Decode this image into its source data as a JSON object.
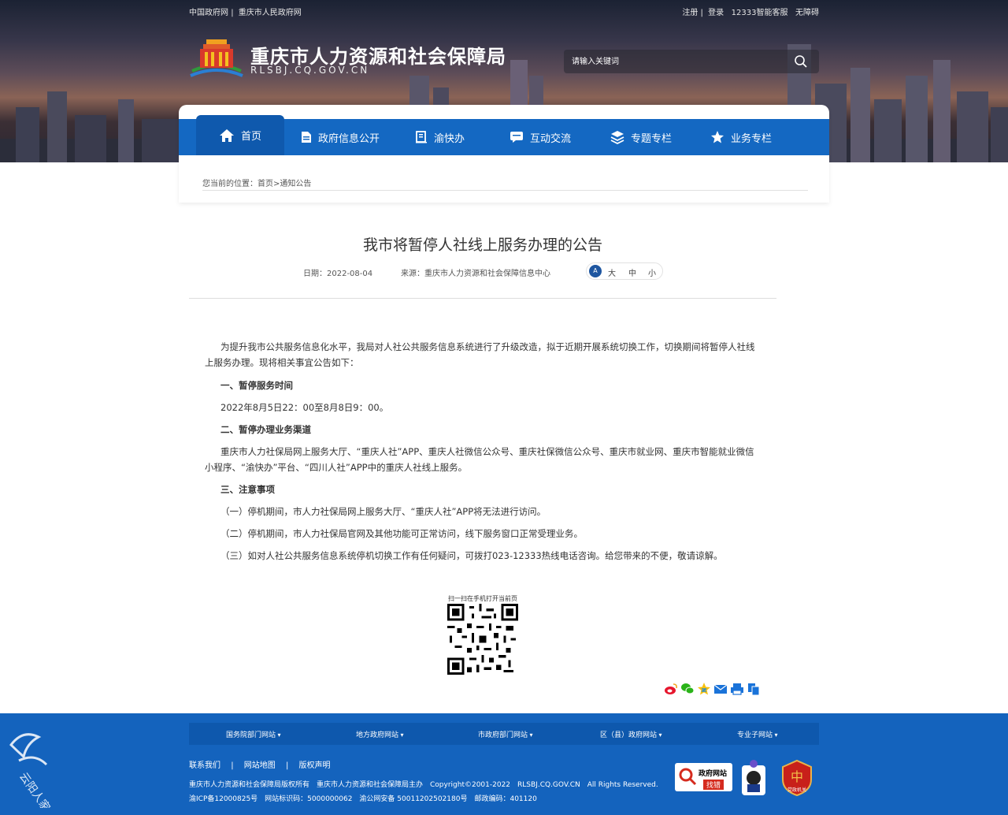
{
  "topbar": {
    "left_link1": "中国政府网",
    "separator": "|",
    "left_link2": "重庆市人民政府网",
    "register": "注册",
    "login": "登录",
    "service": "12333智能客服",
    "accessible": "无障碍"
  },
  "header": {
    "title": "重庆市人力资源和社会保障局",
    "domain": "RLSBJ.CQ.GOV.CN",
    "search_placeholder": "请输入关键词"
  },
  "nav": {
    "items": [
      {
        "label": "首页",
        "icon": "home-icon"
      },
      {
        "label": "政府信息公开",
        "icon": "document-icon"
      },
      {
        "label": "渝快办",
        "icon": "book-icon"
      },
      {
        "label": "互动交流",
        "icon": "chat-icon"
      },
      {
        "label": "专题专栏",
        "icon": "layers-icon"
      },
      {
        "label": "业务专栏",
        "icon": "star-icon"
      }
    ]
  },
  "breadcrumb": {
    "prefix": "您当前的位置：",
    "home": "首页",
    "sep": ">",
    "current": "通知公告"
  },
  "article": {
    "title": "我市将暂停人社线上服务办理的公告",
    "date": "日期：2022-08-04",
    "source": "来源：重庆市人力资源和社会保障信息中心",
    "font_icon": "A",
    "font_large": "大",
    "font_medium": "中",
    "font_small": "小",
    "paragraphs": {
      "p1": "为提升我市公共服务信息化水平，我局对人社公共服务信息系统进行了升级改造，拟于近期开展系统切换工作，切换期间将暂停人社线上服务办理。现将相关事宜公告如下：",
      "h1": "一、暂停服务时间",
      "p2": "2022年8月5日22：00至8月8日9：00。",
      "h2": "二、暂停办理业务渠道",
      "p3": "重庆市人力社保局网上服务大厅、“重庆人社”APP、重庆人社微信公众号、重庆社保微信公众号、重庆市就业网、重庆市智能就业微信小程序、“渝快办”平台、“四川人社”APP中的重庆人社线上服务。",
      "h3": "三、注意事项",
      "i1": "（一）停机期间，市人力社保局网上服务大厅、“重庆人社”APP将无法进行访问。",
      "i2": "（二）停机期间，市人力社保局官网及其他功能可正常访问，线下服务窗口正常受理业务。",
      "i3": "（三）如对人社公共服务信息系统停机切换工作有任何疑问，可拨打023-12333热线电话咨询。给您带来的不便，敬请谅解。"
    },
    "qr_label": "扫一扫在手机打开当前页"
  },
  "share_icons": [
    "weibo-icon",
    "wechat-icon",
    "qzone-icon",
    "email-icon",
    "print-icon",
    "copy-icon"
  ],
  "footer": {
    "link_groups": [
      "国务院部门网站",
      "地方政府网站",
      "市政府部门网站",
      "区（县）政府网站",
      "专业子网站"
    ],
    "nav": [
      "联系我们",
      "网站地图",
      "版权声明"
    ],
    "nav_sep": "|",
    "copy_line1": "重庆市人力资源和社会保障局版权所有　重庆市人力资源和社会保障局主办　Copyright©2001-2022　RLSBJ.CQ.GOV.CN　All Rights Reserved.",
    "copy_line2": "渝ICP备12000825号　网站标识码：5000000062　渝公网安备 50011202502180号　邮政编码：401120",
    "badge_zf_line1": "政府网站",
    "badge_zf_line2": "找错",
    "badge_party": "党政机关"
  },
  "colors": {
    "nav_blue": "#1468c2",
    "nav_active": "#0f59ad",
    "footer_blue": "#1463bd"
  }
}
